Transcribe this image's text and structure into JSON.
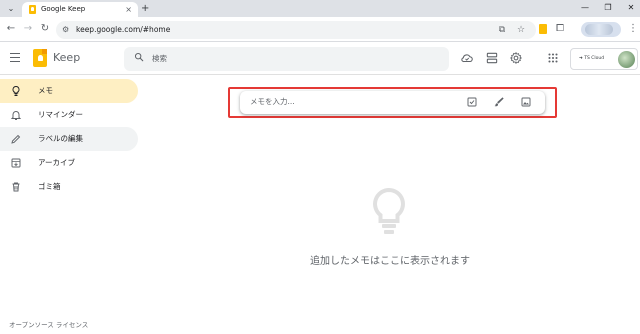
{
  "browser": {
    "tab_title": "Google Keep",
    "tab_close": "×",
    "new_tab": "+",
    "tab_menu": "⌄",
    "url": "keep.google.com/#home",
    "window_controls": [
      "—",
      "❐",
      "✕"
    ],
    "nav": {
      "back": "←",
      "forward": "→",
      "reload": "↻"
    }
  },
  "header": {
    "app_name": "Keep",
    "search_placeholder": "検索",
    "account_label": "TS Cloud"
  },
  "sidebar": {
    "items": [
      {
        "label": "メモ",
        "icon": "lightbulb-icon",
        "state": "active"
      },
      {
        "label": "リマインダー",
        "icon": "bell-icon",
        "state": "normal"
      },
      {
        "label": "ラベルの編集",
        "icon": "pencil-icon",
        "state": "hover"
      },
      {
        "label": "アーカイブ",
        "icon": "archive-icon",
        "state": "normal"
      },
      {
        "label": "ゴミ箱",
        "icon": "trash-icon",
        "state": "normal"
      }
    ]
  },
  "take_note": {
    "placeholder": "メモを入力..."
  },
  "empty_state": {
    "message": "追加したメモはここに表示されます"
  },
  "footer": {
    "link": "オープンソース ライセンス"
  },
  "colors": {
    "accent": "#fbbc04",
    "active_nav": "#feefc3",
    "highlight_border": "#e53935"
  }
}
